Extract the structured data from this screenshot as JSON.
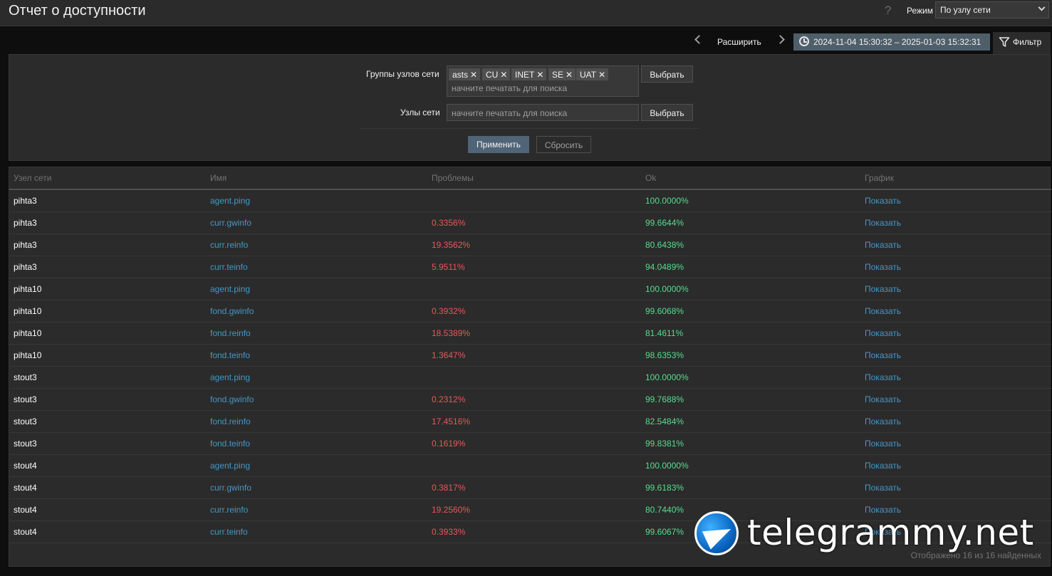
{
  "header": {
    "title": "Отчет о доступности",
    "help": "?",
    "mode_label": "Режим",
    "mode_value": "По узлу сети"
  },
  "tabs": {
    "expand": "Расширить",
    "time_range": "2024-11-04 15:30:32 – 2025-01-03 15:32:31",
    "filter": "Фильтр"
  },
  "filter": {
    "groups_label": "Группы узлов сети",
    "groups": [
      "asts",
      "CU",
      "INET",
      "SE",
      "UAT"
    ],
    "groups_placeholder": "начните печатать для поиска",
    "hosts_label": "Узлы сети",
    "hosts_placeholder": "начните печатать для поиска",
    "select_label": "Выбрать",
    "apply_label": "Применить",
    "reset_label": "Сбросить"
  },
  "table": {
    "columns": [
      "Узел сети",
      "Имя",
      "Проблемы",
      "Ok",
      "График"
    ],
    "rows": [
      {
        "host": "pihta3",
        "name": "agent.ping",
        "problems": "",
        "ok": "100.0000%",
        "graph": "Показать"
      },
      {
        "host": "pihta3",
        "name": "curr.gwinfo",
        "problems": "0.3356%",
        "ok": "99.6644%",
        "graph": "Показать"
      },
      {
        "host": "pihta3",
        "name": "curr.reinfo",
        "problems": "19.3562%",
        "ok": "80.6438%",
        "graph": "Показать"
      },
      {
        "host": "pihta3",
        "name": "curr.teinfo",
        "problems": "5.9511%",
        "ok": "94.0489%",
        "graph": "Показать"
      },
      {
        "host": "pihta10",
        "name": "agent.ping",
        "problems": "",
        "ok": "100.0000%",
        "graph": "Показать"
      },
      {
        "host": "pihta10",
        "name": "fond.gwinfo",
        "problems": "0.3932%",
        "ok": "99.6068%",
        "graph": "Показать"
      },
      {
        "host": "pihta10",
        "name": "fond.reinfo",
        "problems": "18.5389%",
        "ok": "81.4611%",
        "graph": "Показать"
      },
      {
        "host": "pihta10",
        "name": "fond.teinfo",
        "problems": "1.3647%",
        "ok": "98.6353%",
        "graph": "Показать"
      },
      {
        "host": "stout3",
        "name": "agent.ping",
        "problems": "",
        "ok": "100.0000%",
        "graph": "Показать"
      },
      {
        "host": "stout3",
        "name": "fond.gwinfo",
        "problems": "0.2312%",
        "ok": "99.7688%",
        "graph": "Показать"
      },
      {
        "host": "stout3",
        "name": "fond.reinfo",
        "problems": "17.4516%",
        "ok": "82.5484%",
        "graph": "Показать"
      },
      {
        "host": "stout3",
        "name": "fond.teinfo",
        "problems": "0.1619%",
        "ok": "99.8381%",
        "graph": "Показать"
      },
      {
        "host": "stout4",
        "name": "agent.ping",
        "problems": "",
        "ok": "100.0000%",
        "graph": "Показать"
      },
      {
        "host": "stout4",
        "name": "curr.gwinfo",
        "problems": "0.3817%",
        "ok": "99.6183%",
        "graph": "Показать"
      },
      {
        "host": "stout4",
        "name": "curr.reinfo",
        "problems": "19.2560%",
        "ok": "80.7440%",
        "graph": "Показать"
      },
      {
        "host": "stout4",
        "name": "curr.teinfo",
        "problems": "0.3933%",
        "ok": "99.6067%",
        "graph": "Показать"
      }
    ],
    "footer": "Отображено 16 из 16 найденных"
  },
  "watermark": "telegrammy.net",
  "colors": {
    "background": "#0e0e0e",
    "panel": "#2b2b2b",
    "link": "#4796c4",
    "problem": "#e45959",
    "ok": "#59db8f",
    "apply": "#4f6477"
  }
}
